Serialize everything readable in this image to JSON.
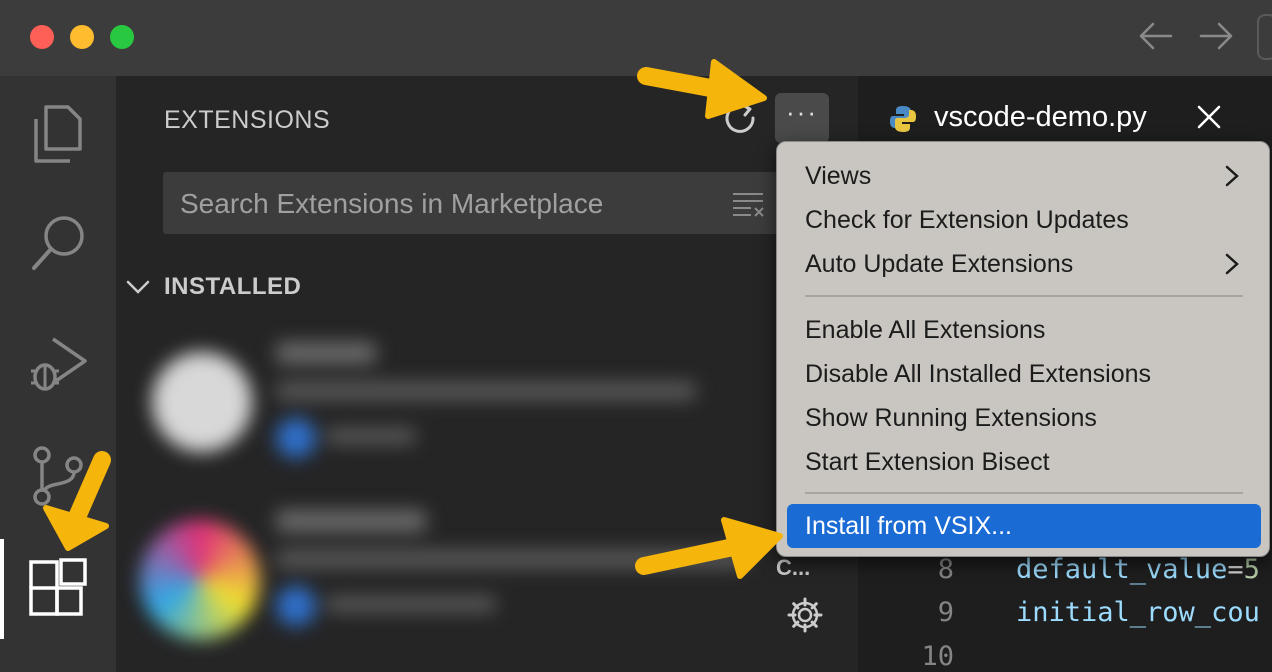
{
  "window": {
    "nav_back_icon": "arrow-left-icon",
    "nav_forward_icon": "arrow-right-icon"
  },
  "activity_bar": {
    "items": [
      {
        "name": "explorer",
        "icon": "files-icon"
      },
      {
        "name": "search",
        "icon": "search-icon"
      },
      {
        "name": "run-and-debug",
        "icon": "debug-icon"
      },
      {
        "name": "source-control",
        "icon": "source-control-icon"
      },
      {
        "name": "extensions",
        "icon": "extensions-icon",
        "active": true
      }
    ]
  },
  "sidebar": {
    "title": "EXTENSIONS",
    "more_label": "···",
    "search_placeholder": "Search Extensions in Marketplace",
    "section_label": "INSTALLED",
    "side_label": "C..."
  },
  "editor": {
    "tab_title": "vscode-demo.py",
    "lines": [
      {
        "num": "8",
        "name": "default_value",
        "op": "=",
        "val": "5"
      },
      {
        "num": "9",
        "name": "initial_row_cou",
        "op": "",
        "val": ""
      },
      {
        "num": "10",
        "name": "",
        "op": "",
        "val": ""
      }
    ]
  },
  "menu": {
    "items": [
      {
        "label": "Views",
        "submenu": true
      },
      {
        "label": "Check for Extension Updates",
        "submenu": false
      },
      {
        "label": "Auto Update Extensions",
        "submenu": true
      },
      {
        "label": "Enable All Extensions",
        "submenu": false
      },
      {
        "label": "Disable All Installed Extensions",
        "submenu": false
      },
      {
        "label": "Show Running Extensions",
        "submenu": false
      },
      {
        "label": "Start Extension Bisect",
        "submenu": false
      },
      {
        "label": "Install from VSIX...",
        "submenu": false,
        "highlighted": true
      }
    ]
  },
  "colors": {
    "highlight": "#1a6bd4",
    "annotation_arrow": "#f5b50a"
  }
}
